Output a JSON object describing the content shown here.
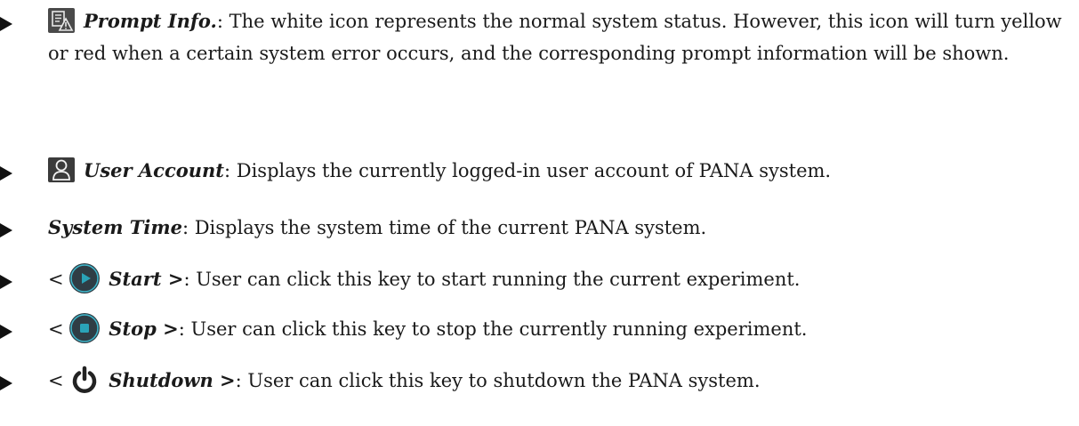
{
  "items": [
    {
      "term": "Prompt Info.",
      "text": ": The white icon represents the normal system status. However, this icon will turn yellow or red when a certain system error occurs, and the corresponding prompt information will be shown.",
      "icon": "prompt-info-icon"
    },
    {
      "term": "User Account",
      "text": ": Displays the currently logged-in user account of PANA system.",
      "icon": "user-icon"
    },
    {
      "term": "System Time",
      "text": ": Displays the system time of the current PANA system."
    },
    {
      "prefix": "<",
      "term": "Start >",
      "text": ": User can click this key to start running the current experiment.",
      "icon": "play-icon"
    },
    {
      "prefix": "<",
      "term": "Stop >",
      "text": ": User can click this key to stop the currently running experiment.",
      "icon": "stop-icon"
    },
    {
      "prefix": "<",
      "term": "Shutdown >",
      "text": ": User can click this key to shutdown the PANA system.",
      "icon": "power-icon"
    }
  ],
  "colors": {
    "text": "#1a1a1a",
    "icon_dark": "#3b3b3b",
    "icon_teal": "#2aa3b8"
  }
}
